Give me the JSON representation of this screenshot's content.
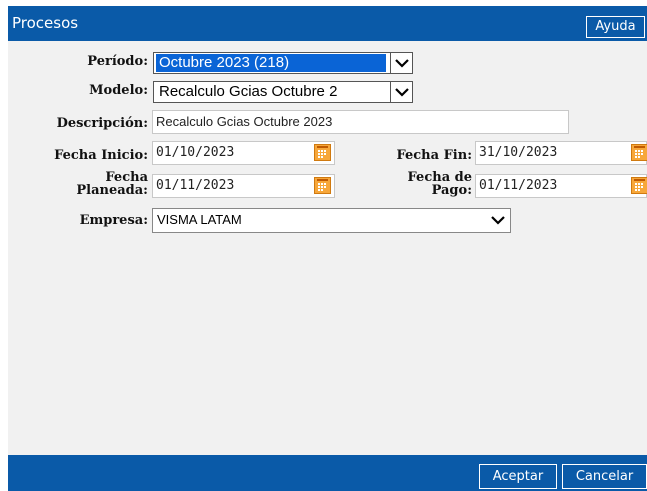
{
  "header": {
    "title": "Procesos",
    "help_label": "Ayuda"
  },
  "form": {
    "periodo": {
      "label": "Período:",
      "value": "Octubre 2023 (218)"
    },
    "modelo": {
      "label": "Modelo:",
      "value": "Recalculo Gcias Octubre 2"
    },
    "descripcion": {
      "label": "Descripción:",
      "value": "Recalculo Gcias Octubre 2023"
    },
    "fecha_inicio": {
      "label": "Fecha Inicio:",
      "value": "01/10/2023"
    },
    "fecha_fin": {
      "label": "Fecha Fin:",
      "value": "31/10/2023"
    },
    "fecha_planeada": {
      "label_line1": "Fecha",
      "label_line2": "Planeada:",
      "value": "01/11/2023"
    },
    "fecha_pago": {
      "label_line1": "Fecha de",
      "label_line2": "Pago:",
      "value": "01/11/2023"
    },
    "empresa": {
      "label": "Empresa:",
      "value": "VISMA LATAM"
    }
  },
  "footer": {
    "accept_label": "Aceptar",
    "cancel_label": "Cancelar"
  },
  "colors": {
    "brand": "#0a5aa8",
    "selection": "#0a64d6",
    "calendar_icon": "#f7a73a"
  },
  "icons": [
    "chevron-down-icon",
    "calendar-icon"
  ]
}
